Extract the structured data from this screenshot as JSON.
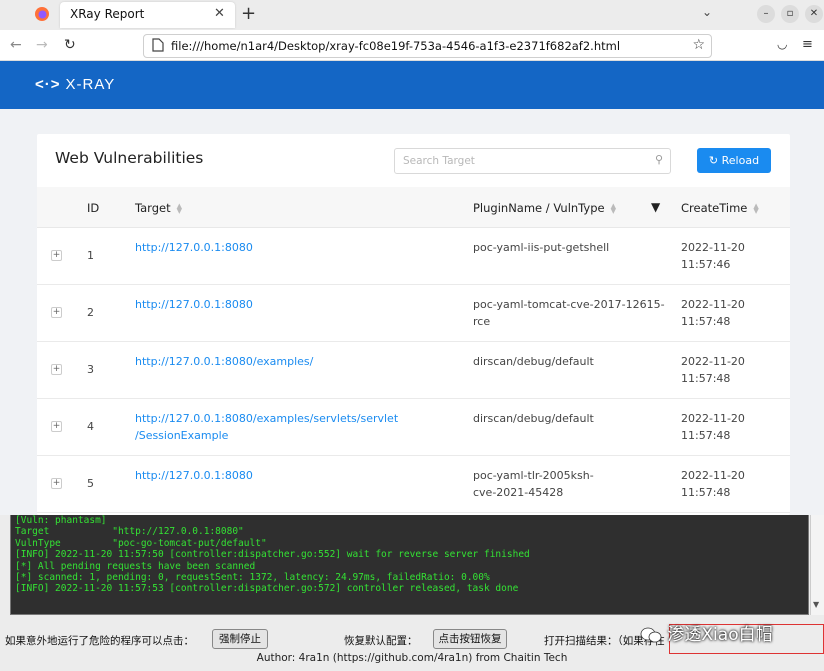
{
  "browser": {
    "tab_title": "XRay Report",
    "url": "file:///home/n1ar4/Desktop/xray-fc08e19f-753a-4546-a1f3-e2371f682af2.html"
  },
  "app": {
    "logo": "X-RAY",
    "card_title": "Web Vulnerabilities",
    "search_placeholder": "Search Target",
    "reload_label": "Reload",
    "columns": {
      "id": "ID",
      "target": "Target",
      "plugin": "PluginName / VulnType",
      "time": "CreateTime"
    },
    "rows": [
      {
        "id": "1",
        "target_l1": "http://127.0.0.1:8080",
        "target_l2": "",
        "plugin_l1": "poc-yaml-iis-put-getshell",
        "plugin_l2": "",
        "date": "2022-11-20",
        "time": "11:57:46"
      },
      {
        "id": "2",
        "target_l1": "http://127.0.0.1:8080",
        "target_l2": "",
        "plugin_l1": "poc-yaml-tomcat-cve-2017-12615-",
        "plugin_l2": "rce",
        "date": "2022-11-20",
        "time": "11:57:48"
      },
      {
        "id": "3",
        "target_l1": "http://127.0.0.1:8080/examples/",
        "target_l2": "",
        "plugin_l1": "dirscan/debug/default",
        "plugin_l2": "",
        "date": "2022-11-20",
        "time": "11:57:48"
      },
      {
        "id": "4",
        "target_l1": "http://127.0.0.1:8080/examples/servlets/servlet",
        "target_l2": "/SessionExample",
        "plugin_l1": "dirscan/debug/default",
        "plugin_l2": "",
        "date": "2022-11-20",
        "time": "11:57:48"
      },
      {
        "id": "5",
        "target_l1": "http://127.0.0.1:8080",
        "target_l2": "",
        "plugin_l1": "poc-yaml-tlr-2005ksh-",
        "plugin_l2": "cve-2021-45428",
        "date": "2022-11-20",
        "time": "11:57:48"
      }
    ]
  },
  "terminal": {
    "lines": [
      "[Vuln: phantasm]",
      "Target           \"http://127.0.0.1:8080\"",
      "VulnType         \"poc-go-tomcat-put/default\"",
      "",
      "[INFO] 2022-11-20 11:57:50 [controller:dispatcher.go:552] wait for reverse server finished",
      "[*] All pending requests have been scanned",
      "[*] scanned: 1, pending: 0, requestSent: 1372, latency: 24.97ms, failedRatio: 0.00%",
      "[INFO] 2022-11-20 11:57:53 [controller:dispatcher.go:572] controller released, task done"
    ]
  },
  "bottom": {
    "label1": "如果意外地运行了危险的程序可以点击：",
    "btn1": "强制停止",
    "label2": "恢复默认配置：",
    "btn2": "点击按钮恢复",
    "label3": "打开扫描结果：（如果存在",
    "author": "Author: 4ra1n (https://github.com/4ra1n) from Chaitin Tech",
    "watermark": "渗透Xiao白帽"
  },
  "colors": {
    "header_blue": "#1466c5",
    "primary": "#1a8bf0",
    "terminal_green": "#34e234"
  }
}
